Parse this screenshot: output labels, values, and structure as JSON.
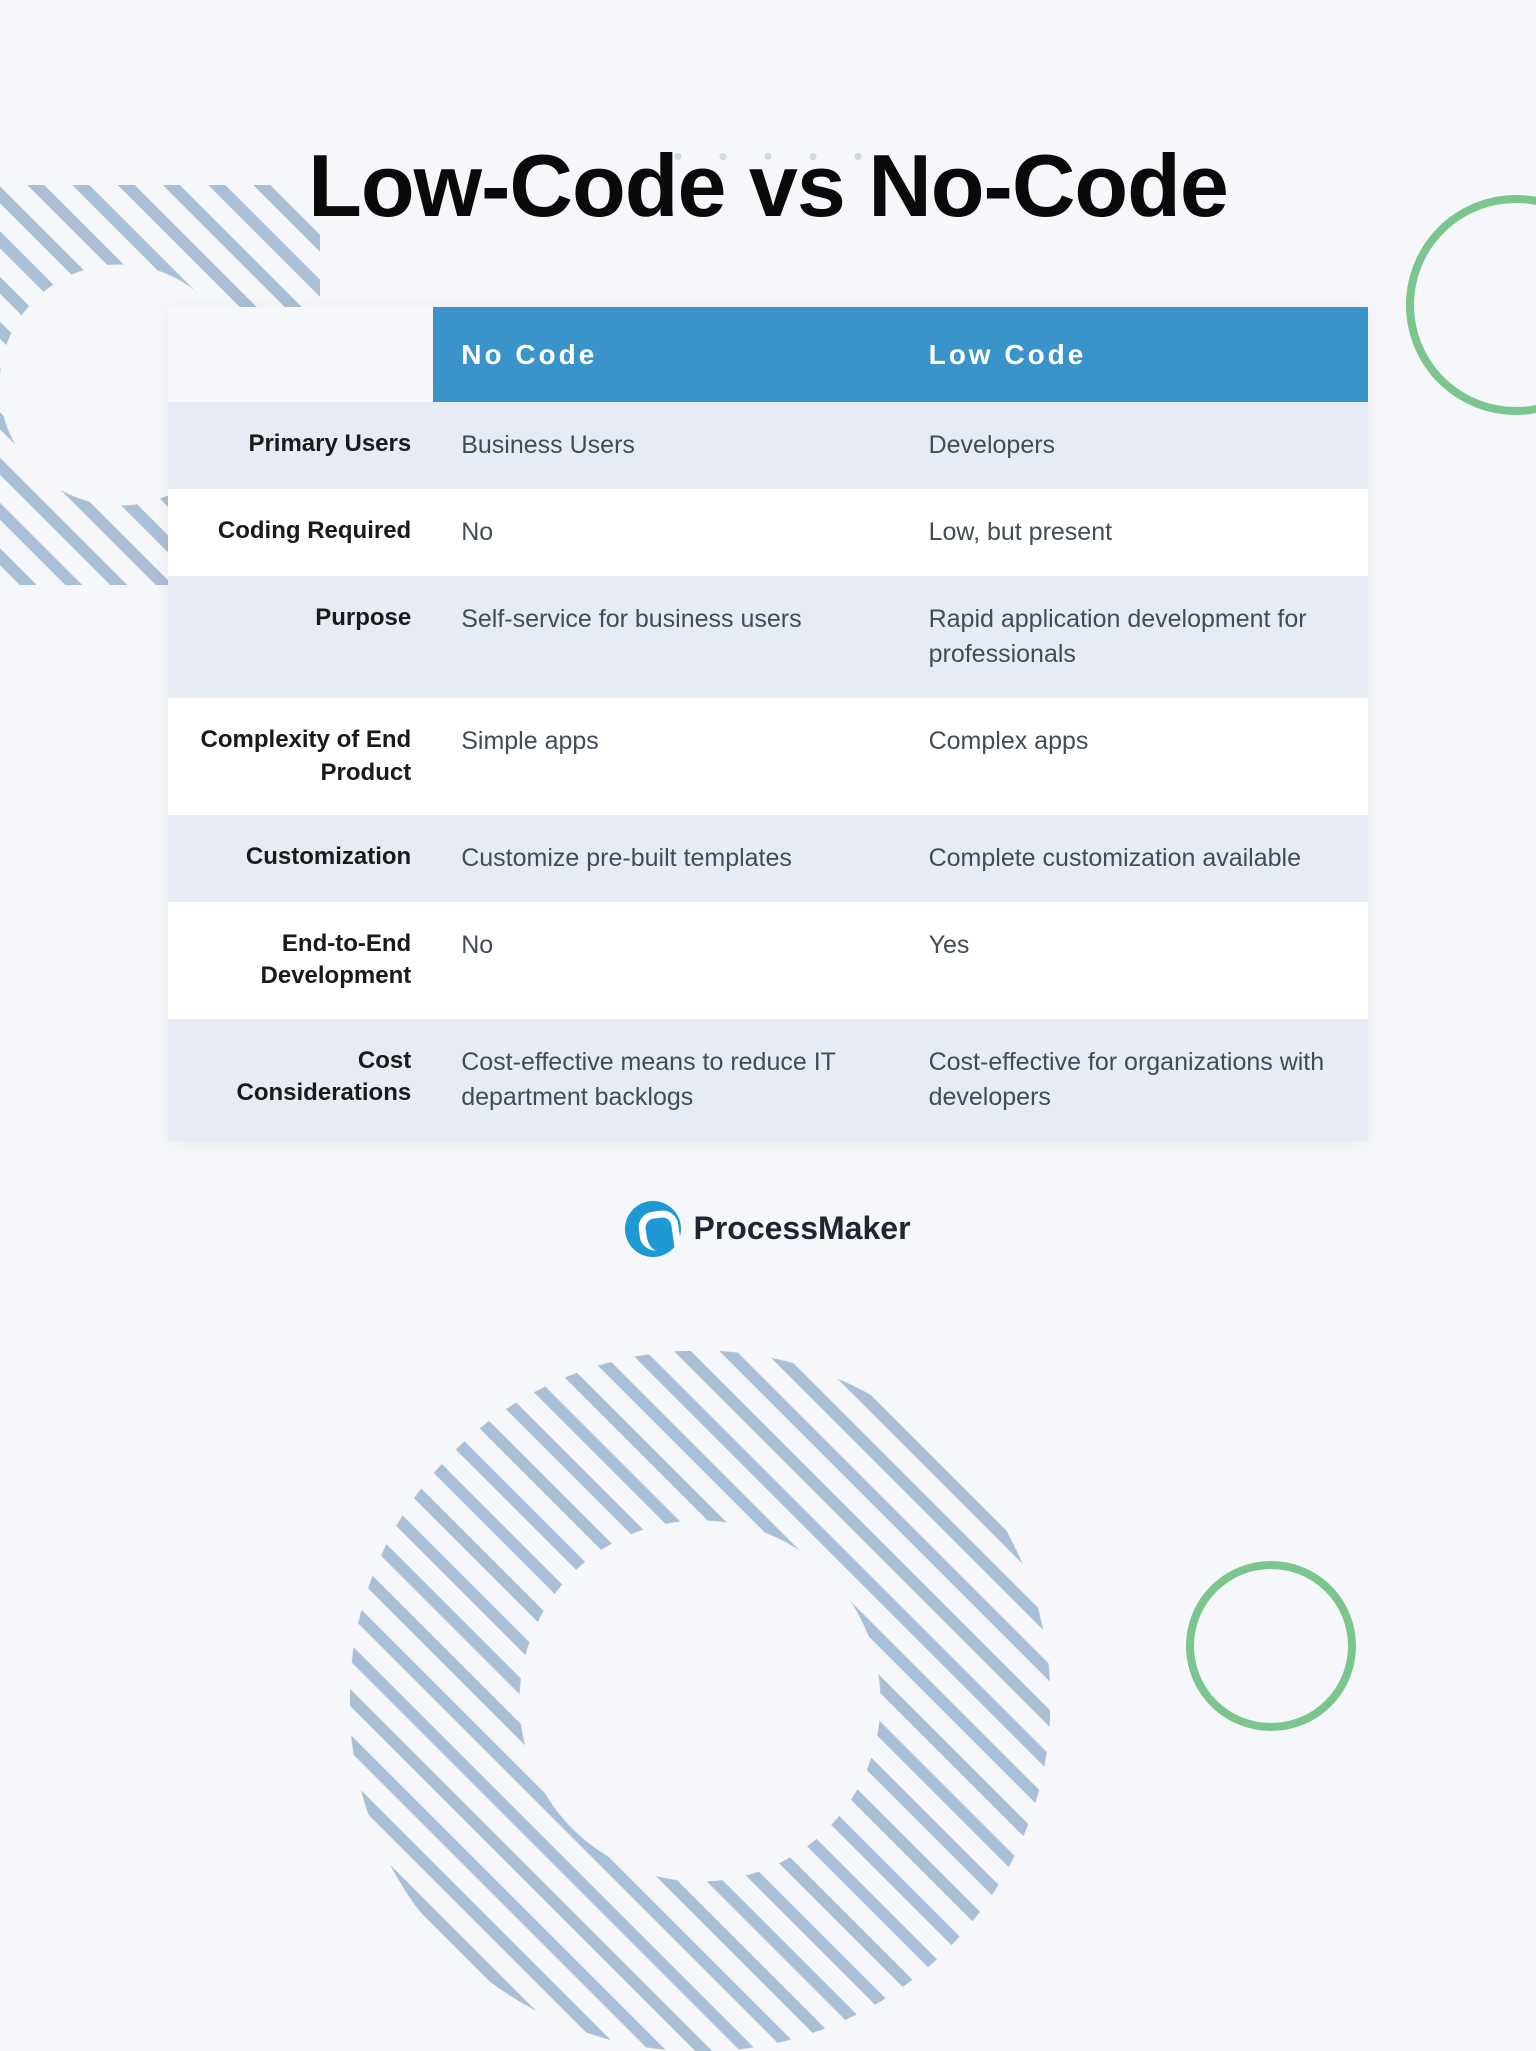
{
  "title": "Low-Code vs No-Code",
  "headers": {
    "col1": "",
    "col2": "No Code",
    "col3": "Low Code"
  },
  "rows": [
    {
      "label": "Primary Users",
      "nocode": "Business Users",
      "lowcode": "Developers"
    },
    {
      "label": "Coding Required",
      "nocode": "No",
      "lowcode": "Low, but present"
    },
    {
      "label": "Purpose",
      "nocode": "Self-service for business users",
      "lowcode": "Rapid application development for professionals"
    },
    {
      "label": "Complexity of End Product",
      "nocode": "Simple apps",
      "lowcode": "Complex apps"
    },
    {
      "label": "Customization",
      "nocode": "Customize pre-built templates",
      "lowcode": "Complete customization available"
    },
    {
      "label": "End-to-End Development",
      "nocode": "No",
      "lowcode": "Yes"
    },
    {
      "label": "Cost Considerations",
      "nocode": "Cost-effective means to reduce IT department backlogs",
      "lowcode": "Cost-effective for organizations with developers"
    }
  ],
  "brand": "ProcessMaker"
}
